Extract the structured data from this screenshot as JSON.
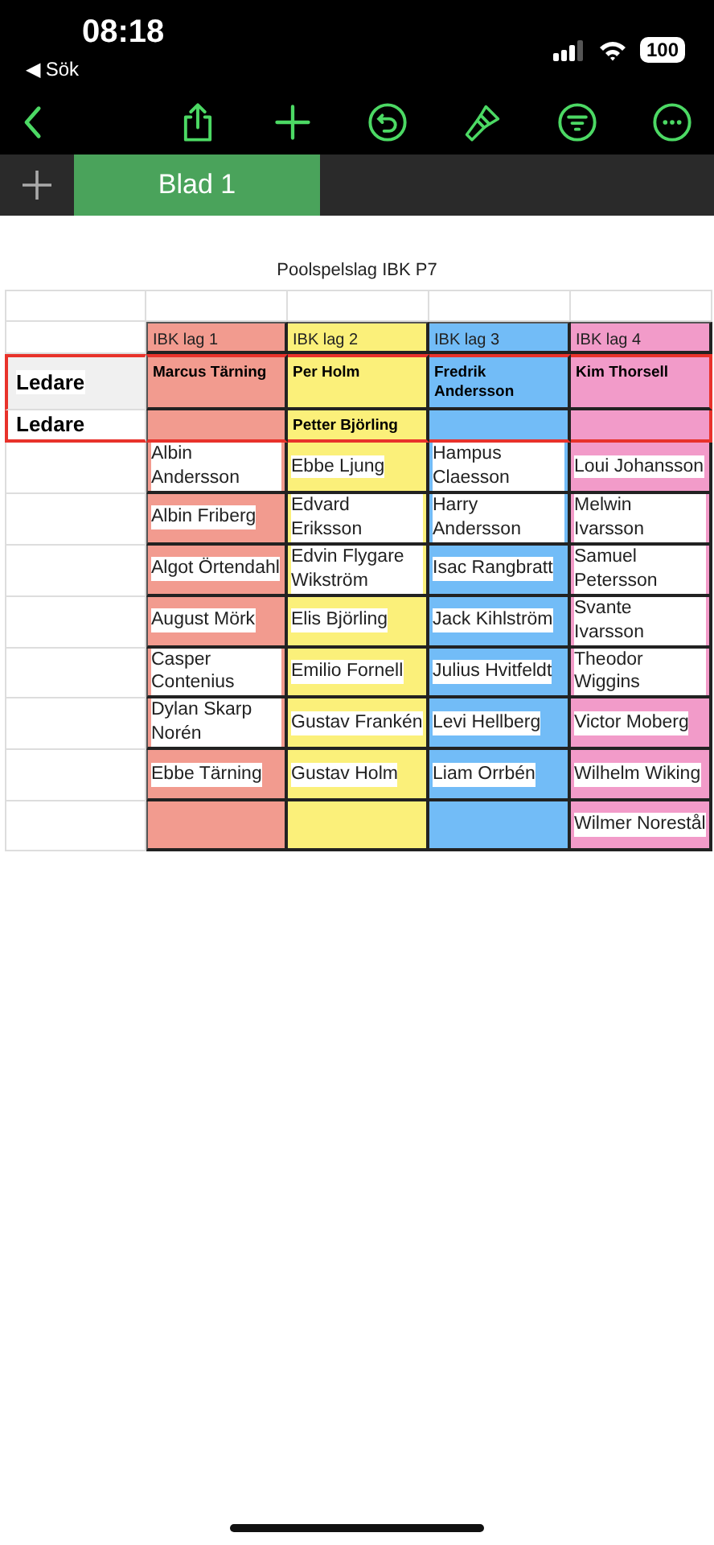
{
  "status_bar": {
    "time": "08:18",
    "back_label": "◀ Sök",
    "battery": "100"
  },
  "sheet_tabs": [
    {
      "label": "Blad 1",
      "selected": true
    }
  ],
  "table": {
    "title": "Poolspelslag IBK P7",
    "columns": [
      {
        "header": "IBK lag 1",
        "color": "#f29b8f"
      },
      {
        "header": "IBK lag 2",
        "color": "#fbf07a"
      },
      {
        "header": "IBK lag 3",
        "color": "#72bcf7"
      },
      {
        "header": "IBK lag 4",
        "color": "#f29bc9"
      }
    ],
    "rows": [
      {
        "kind": "leader",
        "label": "Ledare",
        "selected": true,
        "cells": [
          "Marcus Tärning",
          "Per Holm",
          "Fredrik Andersson",
          "Kim Thorsell"
        ]
      },
      {
        "kind": "leader",
        "label": "Ledare",
        "selected": true,
        "cells": [
          null,
          "Petter Björling",
          null,
          null
        ]
      },
      {
        "kind": "player",
        "selected": false,
        "cells": [
          "Albin Andersson",
          "Ebbe Ljung",
          "Hampus Claesson",
          "Loui Johansson"
        ]
      },
      {
        "kind": "player",
        "selected": false,
        "cells": [
          "Albin Friberg",
          "Edvard Eriksson",
          "Harry Andersson",
          "Melwin Ivarsson"
        ]
      },
      {
        "kind": "player",
        "selected": false,
        "cells": [
          "Algot Örtendahl",
          "Edvin Flygare Wikström",
          "Isac Rangbratt",
          "Samuel Petersson"
        ]
      },
      {
        "kind": "player",
        "selected": false,
        "cells": [
          "August Mörk",
          "Elis Björling",
          "Jack Kihlström",
          "Svante Ivarsson"
        ]
      },
      {
        "kind": "player",
        "selected": false,
        "cells": [
          "Casper Contenius",
          "Emilio Fornell",
          "Julius Hvitfeldt",
          "Theodor Wiggins"
        ]
      },
      {
        "kind": "player",
        "selected": false,
        "cells": [
          "Dylan Skarp Norén",
          "Gustav Frankén",
          "Levi Hellberg",
          "Victor Moberg"
        ]
      },
      {
        "kind": "player",
        "selected": false,
        "cells": [
          "Ebbe Tärning",
          "Gustav Holm",
          "Liam Orrbén",
          "Wilhelm Wiking"
        ]
      },
      {
        "kind": "player",
        "selected": false,
        "cells": [
          null,
          null,
          null,
          "Wilmer Norestål"
        ]
      }
    ]
  }
}
